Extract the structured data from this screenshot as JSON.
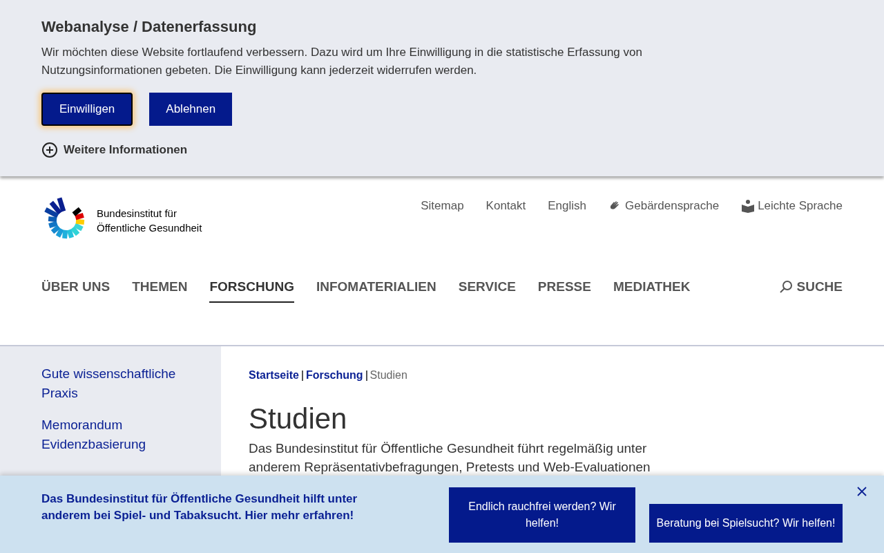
{
  "consent": {
    "title": "Webanalyse / Datenerfassung",
    "text": "Wir möchten diese Website fortlaufend verbessern. Dazu wird um Ihre Einwilligung in die statistische Erfassung von Nutzungsinformationen gebeten. Die Einwilligung kann jederzeit widerrufen werden.",
    "buttons": [
      {
        "label": "Einwilligen",
        "focused": true
      },
      {
        "label": "Ablehnen",
        "focused": false
      }
    ],
    "more": "Weitere Informationen"
  },
  "logo": {
    "line1": "Bundesinstitut für",
    "line2": "Öffentliche Gesundheit"
  },
  "service_links": [
    {
      "label": "Sitemap",
      "kind": "plain"
    },
    {
      "label": "Kontakt",
      "kind": "plain"
    },
    {
      "label": "English",
      "kind": "plain"
    },
    {
      "label": "Gebärdensprache",
      "kind": "sign"
    },
    {
      "label": "Leichte Sprache",
      "kind": "easy"
    }
  ],
  "nav": [
    {
      "label": "ÜBER UNS",
      "selected": false
    },
    {
      "label": "THEMEN",
      "selected": false
    },
    {
      "label": "FORSCHUNG",
      "selected": true
    },
    {
      "label": "INFOMATERIALIEN",
      "selected": false
    },
    {
      "label": "SERVICE",
      "selected": false
    },
    {
      "label": "PRESSE",
      "selected": false
    },
    {
      "label": "MEDIATHEK",
      "selected": false
    }
  ],
  "search": "SUCHE",
  "sidebar": {
    "items": [
      "Gute wissenschaftliche Praxis",
      "Memorandum Evidenzbasierung"
    ]
  },
  "breadcrumb": [
    {
      "label": "Startseite",
      "kind": "link"
    },
    {
      "label": "Forschung",
      "kind": "link"
    },
    {
      "label": "Studien",
      "kind": "current"
    }
  ],
  "heading": "Studien",
  "intro": "Das Bundesinstitut für Öffentliche Gesundheit führt regelmäßig unter anderem Repräsentativbefragungen, Pretests und Web-Evaluationen",
  "promo": {
    "text": "Das Bundesinstitut für Öffentliche Gesundheit hilft unter anderem bei Spiel- und Tabaksucht. Hier mehr erfahren!",
    "buttons": [
      "Endlich rauchfrei werden? Wir helfen!",
      "Beratung bei Spielsucht? Wir helfen!"
    ]
  }
}
